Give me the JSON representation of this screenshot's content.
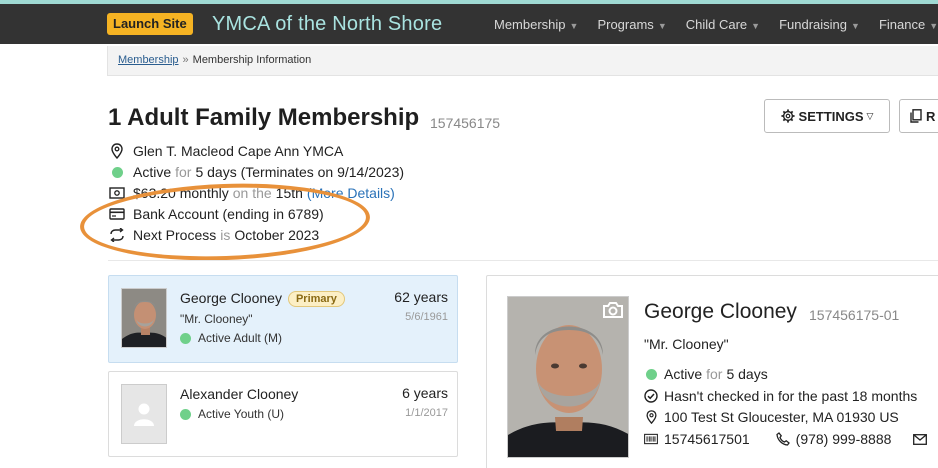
{
  "header": {
    "launch_label": "Launch Site",
    "brand": "YMCA of the North Shore",
    "nav": [
      "Membership",
      "Programs",
      "Child Care",
      "Fundraising",
      "Finance"
    ]
  },
  "breadcrumb": {
    "root": "Membership",
    "separator": "»",
    "current": "Membership Information"
  },
  "membership": {
    "title": "1 Adult Family Membership",
    "id": "157456175",
    "location": "Glen T. Macleod Cape Ann YMCA",
    "status": {
      "label": "Active",
      "for_word": "for",
      "duration": "5 days (Terminates on 9/14/2023)"
    },
    "billing": {
      "amount": "$63.20 monthly",
      "on_word": "on the",
      "day": "15th",
      "link": "(More Details)"
    },
    "payment": "Bank Account (ending in 6789)",
    "next_process": {
      "label": "Next Process",
      "is_word": "is",
      "value": "October 2023"
    }
  },
  "actions": {
    "settings_label": "SETTINGS",
    "second_label": "R"
  },
  "members": [
    {
      "name": "George Clooney",
      "badge": "Primary",
      "nickname": "\"Mr. Clooney\"",
      "status": "Active Adult (M)",
      "age": "62 years",
      "dob": "5/6/1961"
    },
    {
      "name": "Alexander Clooney",
      "status": "Active Youth (U)",
      "age": "6 years",
      "dob": "1/1/2017"
    }
  ],
  "profile": {
    "name": "George Clooney",
    "id": "157456175-01",
    "nickname": "\"Mr. Clooney\"",
    "status_label": "Active",
    "for_word": "for",
    "status_duration": "5 days",
    "checkin": "Hasn't checked in for the past 18 months",
    "address": "100 Test St Gloucester, MA 01930 US",
    "barcode": "15745617501",
    "phone": "(978) 999-8888"
  },
  "colors": {
    "topbar": "#333333",
    "brand": "#a9e3e0",
    "launch": "#f5b323",
    "active_dot": "#6fd08a",
    "highlight": "#e8913a",
    "link": "#2a72b8"
  }
}
